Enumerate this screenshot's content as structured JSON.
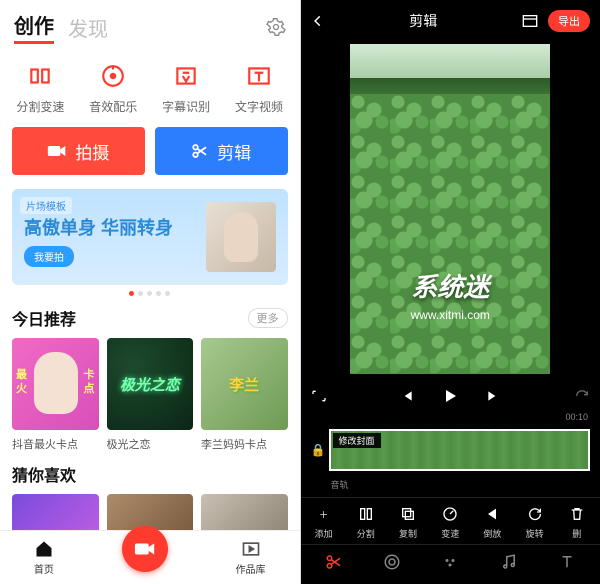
{
  "left": {
    "header": {
      "tab_create": "创作",
      "tab_discover": "发现"
    },
    "tools": [
      {
        "label": "分割变速"
      },
      {
        "label": "音效配乐"
      },
      {
        "label": "字幕识别"
      },
      {
        "label": "文字视频"
      }
    ],
    "shoot_label": "拍摄",
    "edit_label": "剪辑",
    "banner": {
      "tag": "片场模板",
      "title": "高傲单身 华丽转身",
      "cta": "我要拍"
    },
    "section_today": "今日推荐",
    "more": "更多",
    "cards": [
      {
        "left_txt": "最\n火",
        "right_txt": "卡\n点",
        "caption": "抖音最火卡点"
      },
      {
        "title": "极光之恋",
        "caption": "极光之恋"
      },
      {
        "title": "李兰",
        "caption": "李兰妈妈卡点"
      }
    ],
    "section_like": "猜你喜欢",
    "nav": {
      "home": "首页",
      "library": "作品库"
    }
  },
  "right": {
    "title": "剪辑",
    "export": "导出",
    "watermark": "系统迷",
    "watermark_url": "www.xitmi.com",
    "time": "00:10",
    "cover_label": "修改封面",
    "track_label": "音轨",
    "tools": [
      {
        "label": "添加"
      },
      {
        "label": "分割"
      },
      {
        "label": "复制"
      },
      {
        "label": "变速"
      },
      {
        "label": "倒放"
      },
      {
        "label": "旋转"
      },
      {
        "label": "删"
      }
    ]
  }
}
